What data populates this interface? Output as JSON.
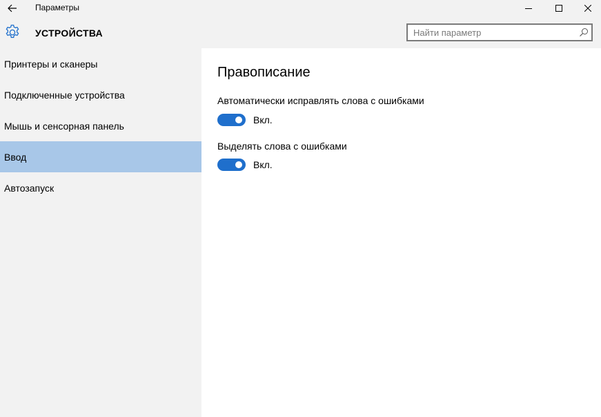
{
  "titlebar": {
    "app_title": "Параметры",
    "back_icon": "back-arrow-icon",
    "minimize_icon": "minimize-icon",
    "maximize_icon": "maximize-icon",
    "close_icon": "close-icon"
  },
  "header": {
    "icon": "gear-icon",
    "title": "УСТРОЙСТВА",
    "search_placeholder": "Найти параметр",
    "search_icon": "search-icon"
  },
  "sidebar": {
    "items": [
      {
        "label": "Принтеры и сканеры",
        "selected": false
      },
      {
        "label": "Подключенные устройства",
        "selected": false
      },
      {
        "label": "Мышь и сенсорная панель",
        "selected": false
      },
      {
        "label": "Ввод",
        "selected": true
      },
      {
        "label": "Автозапуск",
        "selected": false
      }
    ]
  },
  "main": {
    "heading": "Правописание",
    "settings": [
      {
        "label": "Автоматически исправлять слова с ошибками",
        "toggle_on": true,
        "state_text": "Вкл."
      },
      {
        "label": "Выделять слова с ошибками",
        "toggle_on": true,
        "state_text": "Вкл."
      }
    ]
  },
  "colors": {
    "accent": "#1f6fcc",
    "selection": "#a8c7e8",
    "chrome": "#f2f2f2"
  }
}
